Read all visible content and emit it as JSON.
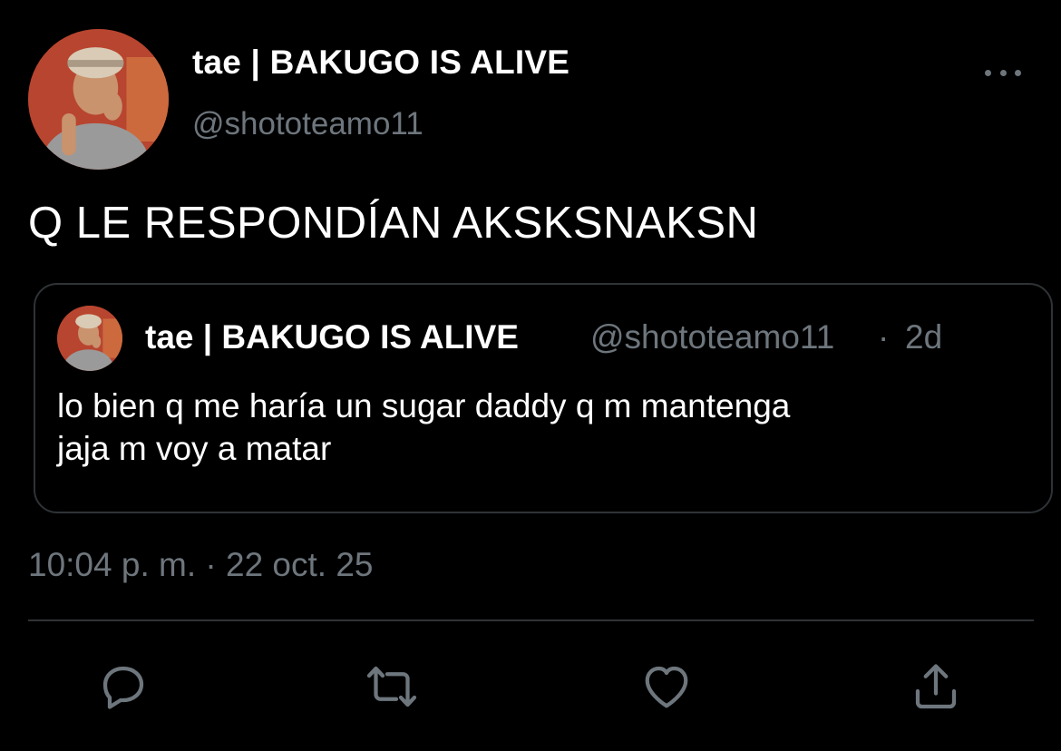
{
  "author": {
    "display_name": "tae | BAKUGO IS ALIVE",
    "handle": "@shototeamo11"
  },
  "tweet": {
    "text": "Q LE RESPONDÍAN AKSKSNAKSN",
    "time": "10:04 p. m.",
    "separator": "·",
    "date": "22 oct. 25"
  },
  "quoted_tweet": {
    "display_name": "tae | BAKUGO IS ALIVE",
    "handle": "@shototeamo11",
    "separator": "·",
    "age": "2d",
    "text_line1": "lo bien q me haría un sugar daddy q m mantenga",
    "text_line2": "jaja m voy a matar"
  },
  "actions": {
    "reply_icon": "reply-icon",
    "retweet_icon": "retweet-icon",
    "like_icon": "heart-icon",
    "share_icon": "share-icon"
  },
  "colors": {
    "background": "#000000",
    "primary_text": "#ffffff",
    "secondary_text": "#6e767d",
    "border": "#2f3336"
  }
}
